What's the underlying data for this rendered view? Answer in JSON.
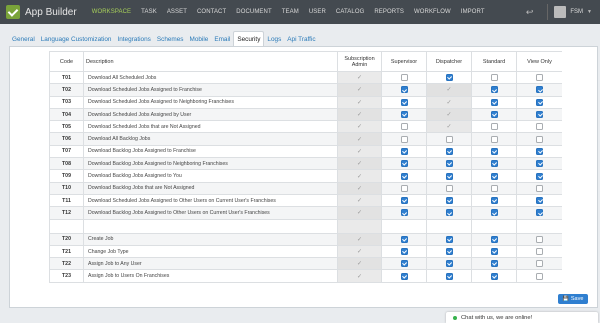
{
  "app": {
    "title": "App Builder",
    "user": "FSM"
  },
  "nav": [
    "WORKSPACE",
    "TASK",
    "ASSET",
    "CONTACT",
    "DOCUMENT",
    "TEAM",
    "USER",
    "CATALOG",
    "REPORTS",
    "WORKFLOW",
    "IMPORT"
  ],
  "nav_active": "WORKSPACE",
  "tabs": [
    "General",
    "Language Customization",
    "Integrations",
    "Schemes",
    "Mobile",
    "Email",
    "Security",
    "Logs",
    "Api Traffic"
  ],
  "tab_active": "Security",
  "columns": [
    "Code",
    "Description",
    "Subscription Admin",
    "Supervisor",
    "Dispatcher",
    "Standard",
    "View Only"
  ],
  "rows": [
    {
      "code": "T01",
      "desc": "Download All Scheduled Jobs",
      "perms": [
        "tick",
        "off",
        "on",
        "off",
        "off"
      ]
    },
    {
      "code": "T02",
      "desc": "Download Scheduled Jobs Assigned to Franchise",
      "perms": [
        "tick",
        "on",
        "tick",
        "on",
        "on"
      ]
    },
    {
      "code": "T03",
      "desc": "Download Scheduled Jobs Assigned to Neighboring Franchises",
      "perms": [
        "tick",
        "on",
        "tick",
        "on",
        "on"
      ]
    },
    {
      "code": "T04",
      "desc": "Download Scheduled Jobs Assigned by User",
      "perms": [
        "tick",
        "on",
        "tick",
        "on",
        "on"
      ]
    },
    {
      "code": "T05",
      "desc": "Download Scheduled Jobs that are Not Assigned",
      "perms": [
        "tick",
        "off",
        "tick",
        "off",
        "off"
      ]
    },
    {
      "code": "T06",
      "desc": "Download All Backlog Jobs",
      "perms": [
        "tick",
        "off",
        "off",
        "off",
        "off"
      ]
    },
    {
      "code": "T07",
      "desc": "Download Backlog Jobs Assigned to Franchise",
      "perms": [
        "tick",
        "on",
        "on",
        "on",
        "on"
      ]
    },
    {
      "code": "T08",
      "desc": "Download Backlog Jobs Assigned to Neighboring Franchises",
      "perms": [
        "tick",
        "on",
        "on",
        "on",
        "on"
      ]
    },
    {
      "code": "T09",
      "desc": "Download Backlog Jobs Assigned to You",
      "perms": [
        "tick",
        "on",
        "on",
        "on",
        "on"
      ]
    },
    {
      "code": "T10",
      "desc": "Download Backlog Jobs that are Not Assigned",
      "perms": [
        "tick",
        "off",
        "off",
        "off",
        "off"
      ]
    },
    {
      "code": "T11",
      "desc": "Download Scheduled Jobs Assigned to Other Users on Current User's Franchises",
      "perms": [
        "tick",
        "on",
        "on",
        "on",
        "on"
      ]
    },
    {
      "code": "T12",
      "desc": "Download Backlog Jobs Assigned to Other Users on Current User's Franchises",
      "perms": [
        "tick",
        "on",
        "on",
        "on",
        "on"
      ]
    },
    {
      "code": "",
      "desc": "",
      "perms": [
        "",
        "",
        "",
        "",
        ""
      ]
    },
    {
      "code": "T20",
      "desc": "Create Job",
      "perms": [
        "tick",
        "on",
        "on",
        "on",
        "off"
      ]
    },
    {
      "code": "T21",
      "desc": "Change Job Type",
      "perms": [
        "tick",
        "on",
        "on",
        "on",
        "off"
      ]
    },
    {
      "code": "T22",
      "desc": "Assign Job to Any User",
      "perms": [
        "tick",
        "on",
        "on",
        "on",
        "off"
      ]
    },
    {
      "code": "T23",
      "desc": "Assign Job to Users On Franchises",
      "perms": [
        "tick",
        "on",
        "on",
        "on",
        "off"
      ]
    }
  ],
  "save_label": "Save",
  "chat_text": "Chat with us, we are online!"
}
